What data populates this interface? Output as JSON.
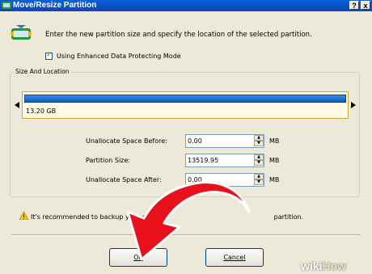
{
  "window": {
    "title": "Move/Resize Partition",
    "help_label": "?",
    "close_label": "x"
  },
  "instruction": "Enter the new partition size and specify the location of the selected partition.",
  "checkbox": {
    "label": "Using Enhanced Data Protecting Mode",
    "checked": true
  },
  "group": {
    "label": "Size And Location"
  },
  "partition": {
    "size_label": "13.20 GB"
  },
  "fields": [
    {
      "label": "Unallocate Space Before:",
      "value": "0.00",
      "unit": "MB"
    },
    {
      "label": "Partition Size:",
      "value": "13519.95",
      "unit": "MB"
    },
    {
      "label": "Unallocate Space After:",
      "value": "0.00",
      "unit": "MB"
    }
  ],
  "warning": {
    "text_start": "It's recommended to backup your dat",
    "text_end": "partition."
  },
  "buttons": {
    "ok": "OK",
    "cancel": "Cancel"
  },
  "watermark": {
    "wiki": "wiki",
    "how": "How"
  },
  "colors": {
    "titlebar": "#0a5fd8",
    "arrow": "#e8101a",
    "partition_bar": "#1868c8"
  },
  "icons": [
    "app-icon",
    "move-resize-icon",
    "check-icon",
    "warning-icon",
    "spin-up-icon",
    "spin-down-icon",
    "red-arrow-icon"
  ]
}
